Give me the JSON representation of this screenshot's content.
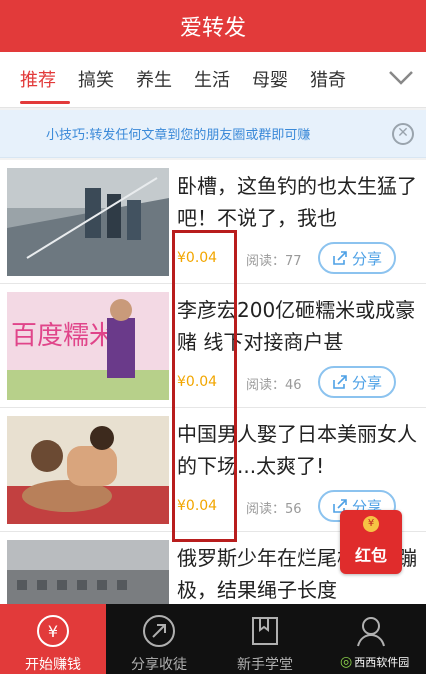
{
  "header": {
    "title": "爱转发"
  },
  "tabs": [
    {
      "label": "推荐",
      "active": true
    },
    {
      "label": "搞笑"
    },
    {
      "label": "养生"
    },
    {
      "label": "生活"
    },
    {
      "label": "母婴"
    },
    {
      "label": "猎奇"
    }
  ],
  "tip": {
    "text": "小技巧:转发任何文章到您的朋友圈或群即可赚",
    "close_icon": "close-icon"
  },
  "articles": [
    {
      "title": "卧槽，这鱼钓的也太生猛了吧！不说了，我也",
      "price": "¥0.04",
      "reads": "阅读：77",
      "share": "分享"
    },
    {
      "title": "李彦宏200亿砸糯米或成豪赌 线下对接商户甚",
      "price": "¥0.04",
      "reads": "阅读：46",
      "share": "分享"
    },
    {
      "title": "中国男人娶了日本美丽女人的下场...太爽了!",
      "price": "¥0.04",
      "reads": "阅读：56",
      "share": "分享"
    },
    {
      "title": "俄罗斯少年在烂尾楼顶玩蹦极，结果绳子长度",
      "price": "",
      "reads": "",
      "share": ""
    }
  ],
  "thumb_sign_text": "百度糯米",
  "redpacket": {
    "label": "红包",
    "seal": "¥"
  },
  "bottom_nav": [
    {
      "label": "开始赚钱",
      "icon": "yuan-circle-icon",
      "active": true
    },
    {
      "label": "分享收徒",
      "icon": "share-arrow-icon"
    },
    {
      "label": "新手学堂",
      "icon": "book-icon"
    },
    {
      "label": "",
      "icon": "user-icon"
    }
  ],
  "watermark": {
    "text": "西西软件园"
  },
  "colors": {
    "brand_red": "#e23a3a",
    "price_orange": "#f2a600",
    "share_blue": "#4ea1e6",
    "tip_bg": "#e7f1fb"
  }
}
